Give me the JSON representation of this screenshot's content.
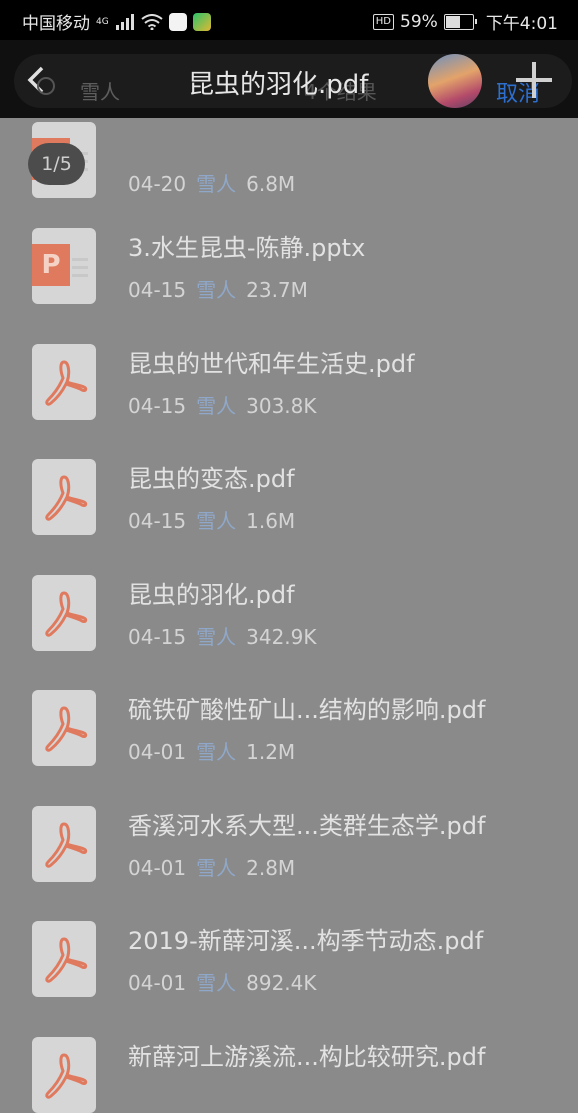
{
  "status_bar": {
    "carrier": "中国移动",
    "network": "4G",
    "battery": "59%",
    "battery_level": 0.59,
    "time": "下午4:01"
  },
  "top_bar": {
    "search_placeholder": "雪人",
    "result_hint": "4个结果",
    "viewer_title": "昆虫的羽化.pdf",
    "cancel_label": "取消"
  },
  "viewer": {
    "page_counter": "1/5"
  },
  "files": [
    {
      "name": "",
      "date": "04-20",
      "uploader": "雪人",
      "size": "6.8M",
      "type": "ppt"
    },
    {
      "name": "3.水生昆虫-陈静.pptx",
      "date": "04-15",
      "uploader": "雪人",
      "size": "23.7M",
      "type": "ppt"
    },
    {
      "name": "昆虫的世代和年生活史.pdf",
      "date": "04-15",
      "uploader": "雪人",
      "size": "303.8K",
      "type": "pdf"
    },
    {
      "name": "昆虫的变态.pdf",
      "date": "04-15",
      "uploader": "雪人",
      "size": "1.6M",
      "type": "pdf"
    },
    {
      "name": "昆虫的羽化.pdf",
      "date": "04-15",
      "uploader": "雪人",
      "size": "342.9K",
      "type": "pdf"
    },
    {
      "name": "硫铁矿酸性矿山...结构的影响.pdf",
      "date": "04-01",
      "uploader": "雪人",
      "size": "1.2M",
      "type": "pdf"
    },
    {
      "name": "香溪河水系大型...类群生态学.pdf",
      "date": "04-01",
      "uploader": "雪人",
      "size": "2.8M",
      "type": "pdf"
    },
    {
      "name": "2019-新薛河溪...构季节动态.pdf",
      "date": "04-01",
      "uploader": "雪人",
      "size": "892.4K",
      "type": "pdf"
    },
    {
      "name": "新薛河上游溪流...构比较研究.pdf",
      "date": "",
      "uploader": "",
      "size": "",
      "type": "pdf"
    }
  ]
}
